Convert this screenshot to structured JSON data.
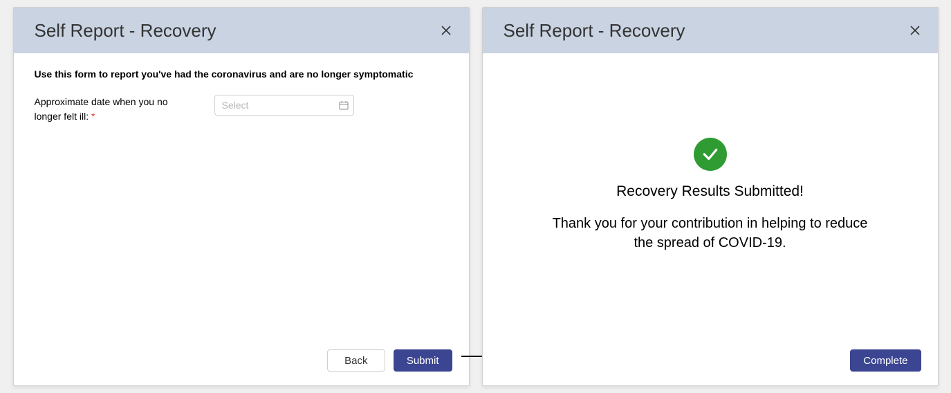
{
  "left_modal": {
    "title": "Self Report - Recovery",
    "instruction": "Use this form to report you've had the coronavirus and are no longer symptomatic",
    "date_label": "Approximate  date when you no longer felt ill: ",
    "required_marker": "*",
    "date_placeholder": "Select",
    "back_label": "Back",
    "submit_label": "Submit"
  },
  "right_modal": {
    "title": "Self Report - Recovery",
    "success_title": "Recovery Results Submitted!",
    "success_message": "Thank you for your contribution in helping to reduce the spread of COVID-19.",
    "complete_label": "Complete"
  },
  "colors": {
    "header_bg": "#c9d3e2",
    "primary_btn": "#3b4592",
    "success_green": "#2e9c33",
    "required_red": "#e53935"
  }
}
